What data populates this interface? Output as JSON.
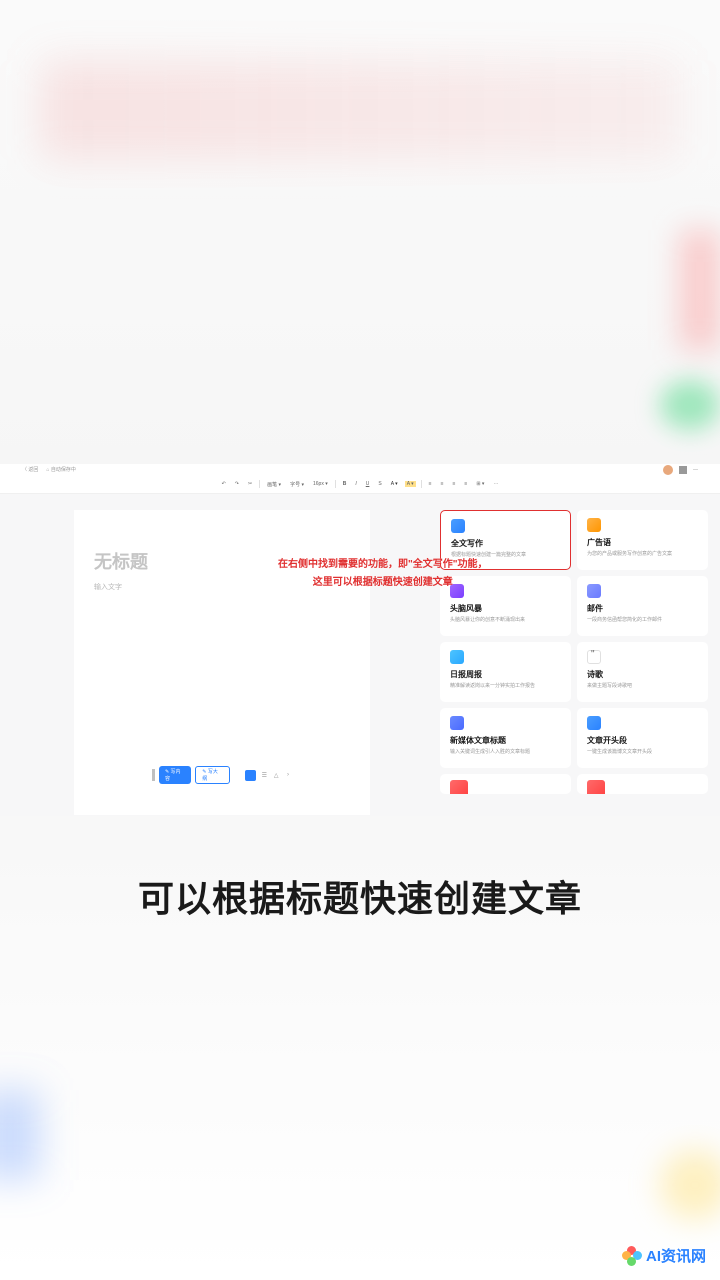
{
  "topbar": {
    "autosave": "自动保存中",
    "back": "〈 返回"
  },
  "toolbar": {
    "items": [
      "↩",
      "↪",
      "✂",
      "画笔",
      "字号",
      "16px",
      "B",
      "I",
      "U",
      "S",
      "A",
      "A",
      "≡",
      "≡",
      "≡",
      "≡",
      "≡",
      "⊞"
    ],
    "undo": "↩",
    "redo": "↪"
  },
  "document": {
    "title_placeholder": "无标题",
    "body_placeholder": "输入文字"
  },
  "bottombar": {
    "btn1": "✎ 写内容",
    "btn2": "✎ 写大纲"
  },
  "annotation": {
    "line1": "在右侧中找到需要的功能，即\"全文写作\"功能，",
    "line2": "这里可以根据标题快速创建文章"
  },
  "cards": [
    {
      "title": "全文写作",
      "desc": "根据标题快速创建一篇完整的文章",
      "icon": "icon-doc",
      "highlight": true
    },
    {
      "title": "广告语",
      "desc": "为您的产品或服务写作创意的广告文案",
      "icon": "icon-ads",
      "highlight": false
    },
    {
      "title": "头脑风暴",
      "desc": "头脑风暴让你的创意不断涌现出来",
      "icon": "icon-brain",
      "highlight": false
    },
    {
      "title": "邮件",
      "desc": "一段商务信函帮您简化的工作邮件",
      "icon": "icon-mail",
      "highlight": false
    },
    {
      "title": "日报周报",
      "desc": "精准解读返岗以来一分钟实拍工作报告",
      "icon": "icon-report",
      "highlight": false
    },
    {
      "title": "诗歌",
      "desc": "来做主题写段诗歌吧",
      "icon": "icon-poem",
      "highlight": false
    },
    {
      "title": "新媒体文章标题",
      "desc": "输入关键词生成引人入胜的文章标题",
      "icon": "icon-media",
      "highlight": false
    },
    {
      "title": "文章开头段",
      "desc": "一键生成该篇博文文章开头段",
      "icon": "icon-para",
      "highlight": false
    }
  ],
  "caption": "可以根据标题快速创建文章",
  "watermark": "AI资讯网"
}
